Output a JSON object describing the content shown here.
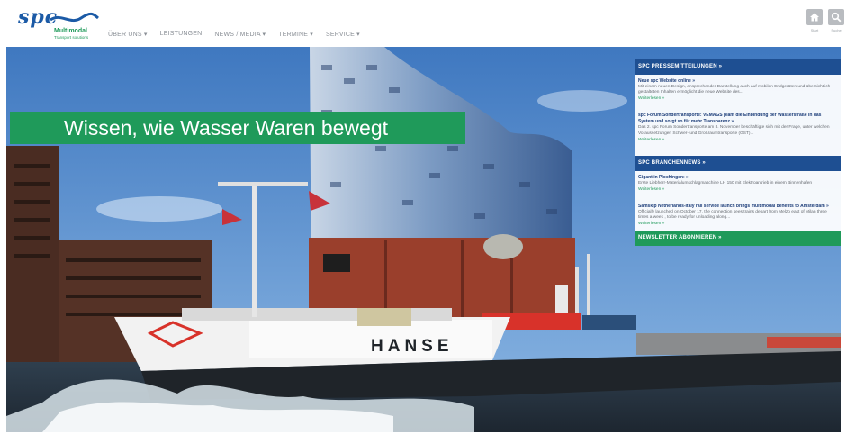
{
  "logo": {
    "brand": "spc",
    "tagline": "Multimodal",
    "subline": "Transport solutions"
  },
  "nav": {
    "items": [
      {
        "label": "ÜBER UNS ▾"
      },
      {
        "label": "LEISTUNGEN"
      },
      {
        "label": "NEWS / MEDIA ▾"
      },
      {
        "label": "TERMINE ▾"
      },
      {
        "label": "SERVICE ▾"
      }
    ]
  },
  "toolbar": {
    "home_icon": "home-icon",
    "search_icon": "search-icon",
    "home_caption": "Start",
    "search_caption": "Suche",
    "icon_color": "#b9bcc0"
  },
  "hero": {
    "slogan": "Wissen, wie Wasser Waren bewegt",
    "ship_name": "HANSE",
    "accent_green": "#1f9a5a",
    "accent_blue": "#1e4f92"
  },
  "sidebar": {
    "press": {
      "header": "SPC PRESSEMITTEILUNGEN »",
      "items": [
        {
          "title": "Neue spc Website online »",
          "text": "Mit einem neuen Design, ansprechender Darstellung auch auf mobilen Endgeräten und übersichtlich gestalteten Inhalten ermöglicht die neue Website des...",
          "more": "Weiterlesen »"
        },
        {
          "title": "spc Forum Sondertransporte: VEMAGS plant die Einbindung der Wasserstraße in das System und sorgt so für mehr Transparenz »",
          "text": "Das 2. spc Forum Sondertransporte am 8. November beschäftigte sich mit der Frage, unter welchen Voraussetzungen Schwer- und Großraumtransporte (GST)...",
          "more": "Weiterlesen »"
        }
      ]
    },
    "industry": {
      "header": "SPC BRANCHENNEWS »",
      "items": [
        {
          "title": "Gigant in Plochingen: »",
          "text": "Erste Liebherr-Materialumschlagmaschine LH 150 mit Elektroantrieb in einem Binnenhafen",
          "more": "Weiterlesen »"
        },
        {
          "title": "Samskip Netherlands-Italy rail service launch brings multimodal benefits to Amsterdam »",
          "text": "Officially launched on October 17, the connection sees trains depart from Melzo east of Milan three times a week , to be ready for unloading along...",
          "more": "Weiterlesen »"
        }
      ]
    },
    "newsletter": {
      "header": "NEWSLETTER ABONNIEREN »"
    }
  }
}
